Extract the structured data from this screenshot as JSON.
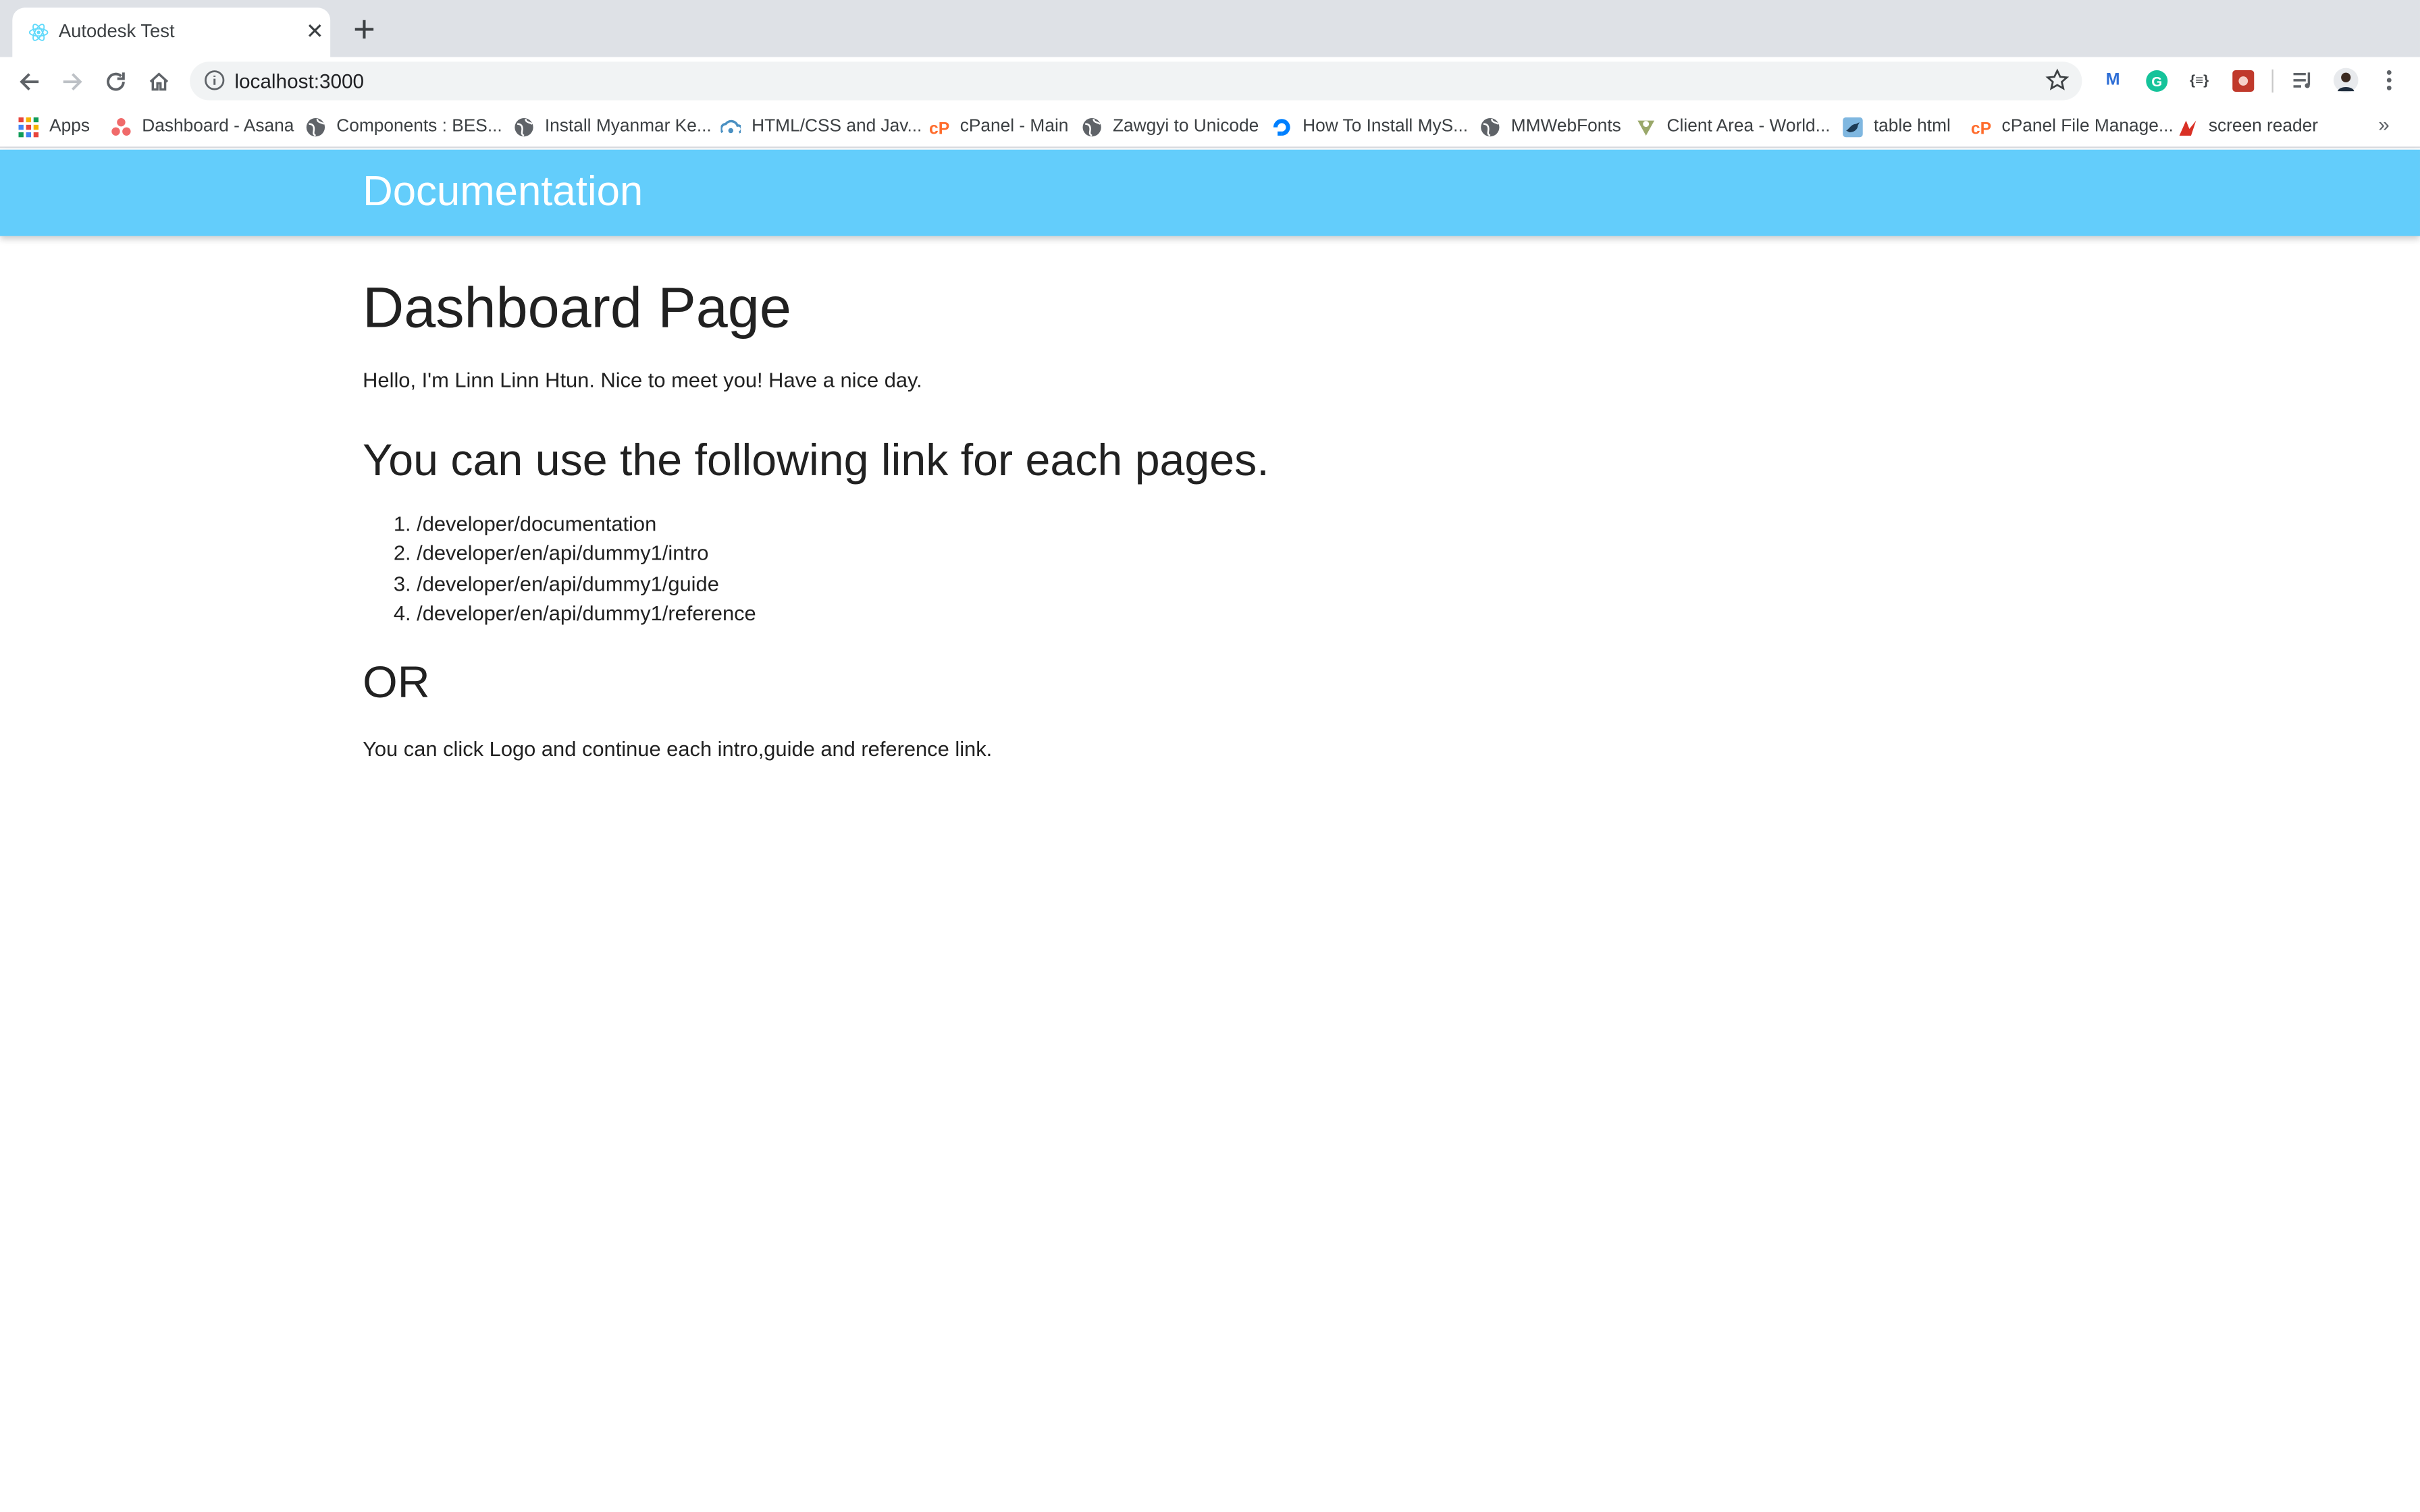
{
  "browser": {
    "tab_title": "Autodesk Test",
    "url": "localhost:3000",
    "bookmarks": [
      {
        "label": "Apps",
        "icon": "apps-grid-icon"
      },
      {
        "label": "Dashboard - Asana",
        "icon": "asana-icon"
      },
      {
        "label": "Components : BES...",
        "icon": "globe-icon"
      },
      {
        "label": "Install Myanmar Ke...",
        "icon": "globe-icon"
      },
      {
        "label": "HTML/CSS and Jav...",
        "icon": "cloud-icon"
      },
      {
        "label": "cPanel - Main",
        "icon": "cpanel-icon"
      },
      {
        "label": "Zawgyi to Unicode",
        "icon": "globe-icon"
      },
      {
        "label": "How To Install MyS...",
        "icon": "digitalocean-icon"
      },
      {
        "label": "MMWebFonts",
        "icon": "globe-icon"
      },
      {
        "label": "Client Area - World...",
        "icon": "worldhost-icon"
      },
      {
        "label": "table html",
        "icon": "bird-icon"
      },
      {
        "label": "cPanel File Manage...",
        "icon": "cpanel-icon"
      },
      {
        "label": "screen reader",
        "icon": "screen-reader-icon"
      }
    ],
    "more_bookmarks": "»"
  },
  "site": {
    "brand": "Documentation"
  },
  "page": {
    "title": "Dashboard Page",
    "greeting": "Hello, I'm Linn Linn Htun. Nice to meet you! Have a nice day.",
    "links_heading": "You can use the following link for each pages.",
    "links": [
      "/developer/documentation",
      "/developer/en/api/dummy1/intro",
      "/developer/en/api/dummy1/guide",
      "/developer/en/api/dummy1/reference"
    ],
    "or_heading": "OR",
    "footer_text": "You can click Logo and continue each intro,guide and reference link."
  },
  "colors": {
    "header_bg": "#63cdfb",
    "header_text": "#ffffff",
    "tabstrip_bg": "#dee1e6"
  }
}
